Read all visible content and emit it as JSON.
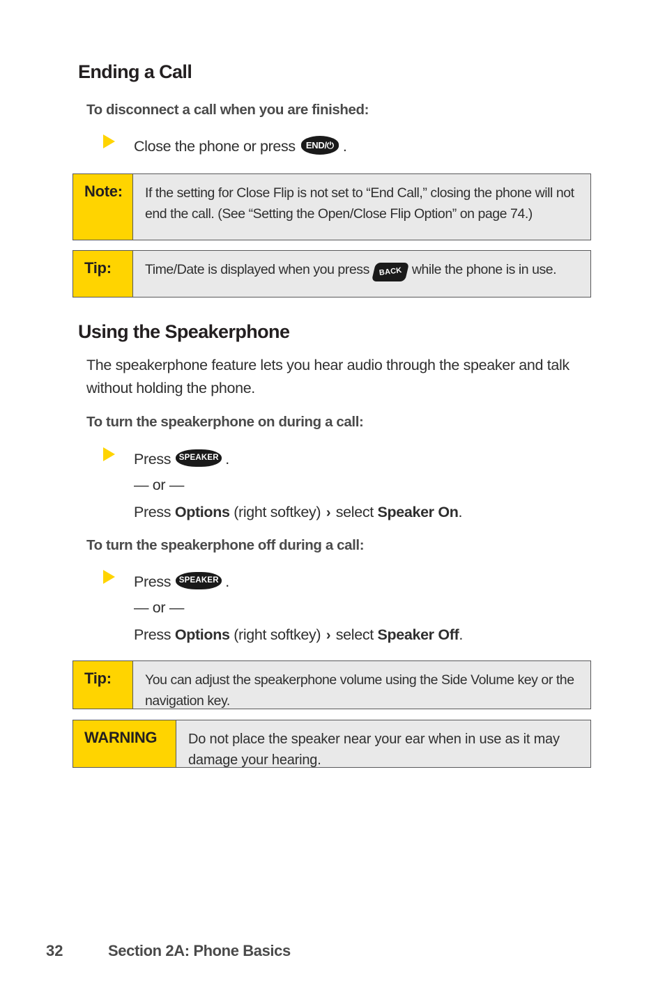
{
  "page": {
    "number": "32",
    "section": "Section 2A: Phone Basics"
  },
  "colors": {
    "accent_yellow": "#FFD400",
    "callout_body_bg": "#E9E9E9",
    "callout_border": "#58585A",
    "key_black": "#1A1A1A",
    "text": "#2F2F2F"
  },
  "sections": [
    {
      "heading": "Ending a Call",
      "subheading": "To disconnect a call when you are finished:",
      "bullet": {
        "text_before": "Close the phone or press",
        "key_label": "END/⏻",
        "text_after": "."
      }
    },
    {
      "heading": "Using the Speakerphone",
      "paragraph": "The speakerphone feature lets you hear audio through the speaker and talk without holding the phone.",
      "subheading_on": "To turn the speakerphone on during a call:",
      "subheading_off": "To turn the speakerphone off during a call:"
    }
  ],
  "speaker_on": {
    "press_label": "Press",
    "key_label": "SPEAKER",
    "period": ".",
    "or_divider": "— or —",
    "alt_press": "Press",
    "alt_bold_1": "Options",
    "alt_mid": "(right softkey)",
    "alt_chevron": "›",
    "alt_select": "select",
    "alt_bold_2": "Speaker On",
    "alt_end": "."
  },
  "speaker_off": {
    "press_label": "Press",
    "key_label": "SPEAKER",
    "period": ".",
    "or_divider": "— or —",
    "alt_press": "Press",
    "alt_bold_1": "Options",
    "alt_mid": "(right softkey)",
    "alt_chevron": "›",
    "alt_select": "select",
    "alt_bold_2": "Speaker Off",
    "alt_end": "."
  },
  "callouts": {
    "note_1": {
      "label": "Note:",
      "body": "If the setting for Close Flip is not set to “End Call,” closing the phone will not end the call. (See “Setting the Open/Close Flip Option” on page 74.)"
    },
    "tip_1": {
      "label": "Tip:",
      "body_before": "Time/Date is displayed when you press",
      "key_label": "BACK",
      "body_after": "while the phone is in use."
    },
    "tip_2": {
      "label": "Tip:",
      "body": "You can adjust the speakerphone volume using the Side Volume key or the navigation key."
    },
    "warning": {
      "label": "WARNING",
      "body": "Do not place the speaker near your ear when in use as it may damage your hearing."
    }
  }
}
